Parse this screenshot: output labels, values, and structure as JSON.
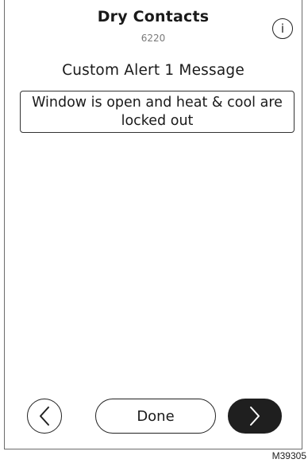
{
  "header": {
    "title": "Dry Contacts",
    "code": "6220",
    "info_label": "i"
  },
  "main": {
    "heading": "Custom Alert 1 Message",
    "message_value": "Window is open and heat & cool are locked out"
  },
  "nav": {
    "back_icon": "chevron-left-icon",
    "done_label": "Done",
    "next_icon": "chevron-right-icon",
    "next_color": "#1f1f1f"
  },
  "figure_id": "M39305"
}
